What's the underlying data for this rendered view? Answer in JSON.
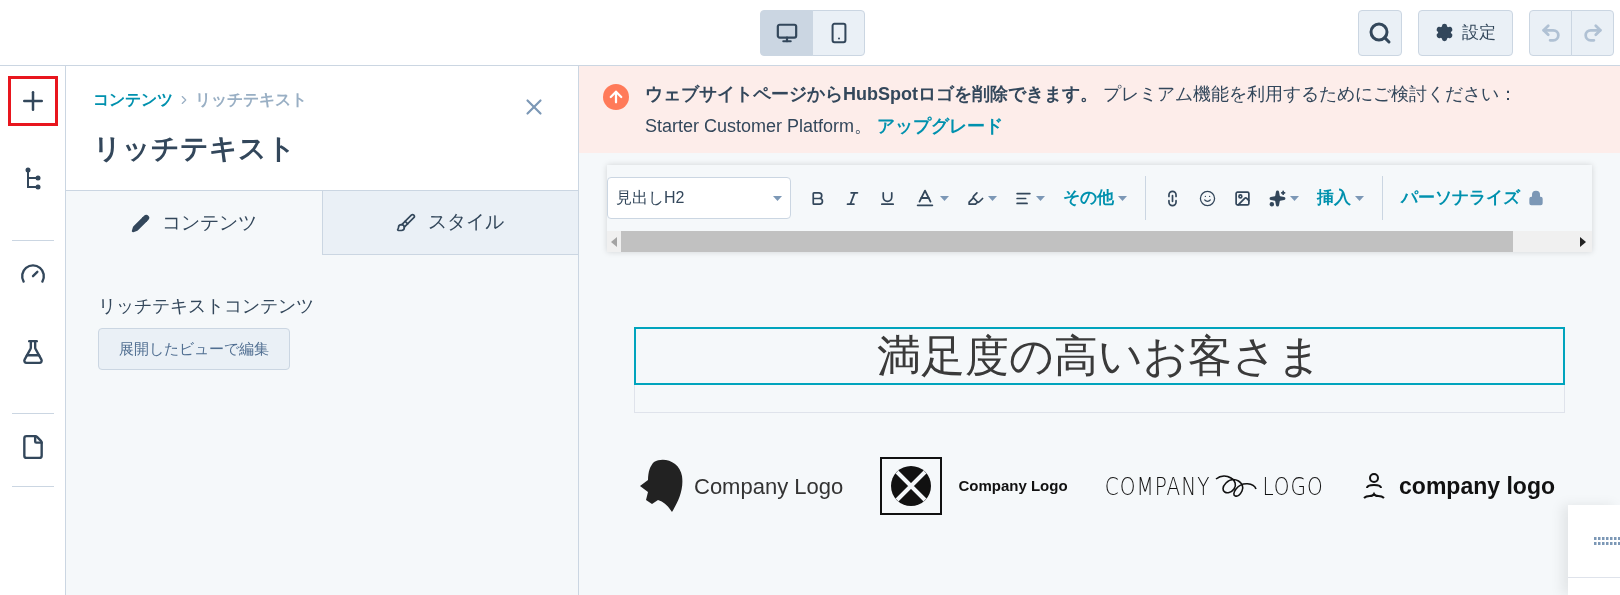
{
  "device_toggle": [
    {
      "kind": "desktop",
      "selected": true
    },
    {
      "kind": "mobile",
      "selected": false
    }
  ],
  "top_actions": {
    "settings_label": "設定",
    "undo_disabled": true,
    "redo_disabled": true
  },
  "rail": [
    {
      "kind": "add",
      "highlighted": true
    },
    {
      "kind": "tree",
      "highlighted": false
    },
    {
      "kind": "gauge",
      "highlighted": false
    },
    {
      "kind": "flask",
      "highlighted": false
    },
    {
      "kind": "file",
      "highlighted": false
    }
  ],
  "panel": {
    "breadcrumb": [
      "コンテンツ",
      "リッチテキスト"
    ],
    "title": "リッチテキスト",
    "tabs": [
      {
        "kind": "content",
        "label": "コンテンツ",
        "selected": true
      },
      {
        "kind": "style",
        "label": "スタイル",
        "selected": false
      }
    ],
    "field_label": "リッチテキストコンテンツ",
    "edit_button": "展開したビューで編集"
  },
  "banner": {
    "text": "**ウェブサイトページからHubSpotロゴを削除できます。** プレミアム機能を利用するためにご検討ください： Starter Customer Platform。",
    "link": "アップグレード"
  },
  "toolbar": {
    "format": "見出しH2",
    "items": [
      {
        "kind": "bold",
        "caret": false
      },
      {
        "kind": "italic",
        "caret": false
      },
      {
        "kind": "underline",
        "caret": false
      },
      {
        "kind": "text-color",
        "caret": true
      },
      {
        "kind": "highlight",
        "caret": true
      },
      {
        "kind": "align",
        "caret": true
      },
      {
        "kind": "menu",
        "label": "その他"
      },
      {
        "kind": "divider"
      },
      {
        "kind": "link",
        "caret": false
      },
      {
        "kind": "emoji",
        "caret": false
      },
      {
        "kind": "image",
        "caret": false
      },
      {
        "kind": "sparkle",
        "caret": true
      },
      {
        "kind": "menu",
        "label": "挿入"
      },
      {
        "kind": "divider"
      },
      {
        "kind": "locked-menu",
        "label": "パーソナライズ"
      }
    ]
  },
  "heading": "満足度の高いお客さま",
  "logos": [
    {
      "kind": "lion",
      "text": "Company Logo"
    },
    {
      "kind": "square",
      "text": "Company Logo"
    },
    {
      "kind": "scribble",
      "text": "COMPANY",
      "text_2": "LOGO"
    },
    {
      "kind": "figure",
      "text": "company logo"
    }
  ]
}
